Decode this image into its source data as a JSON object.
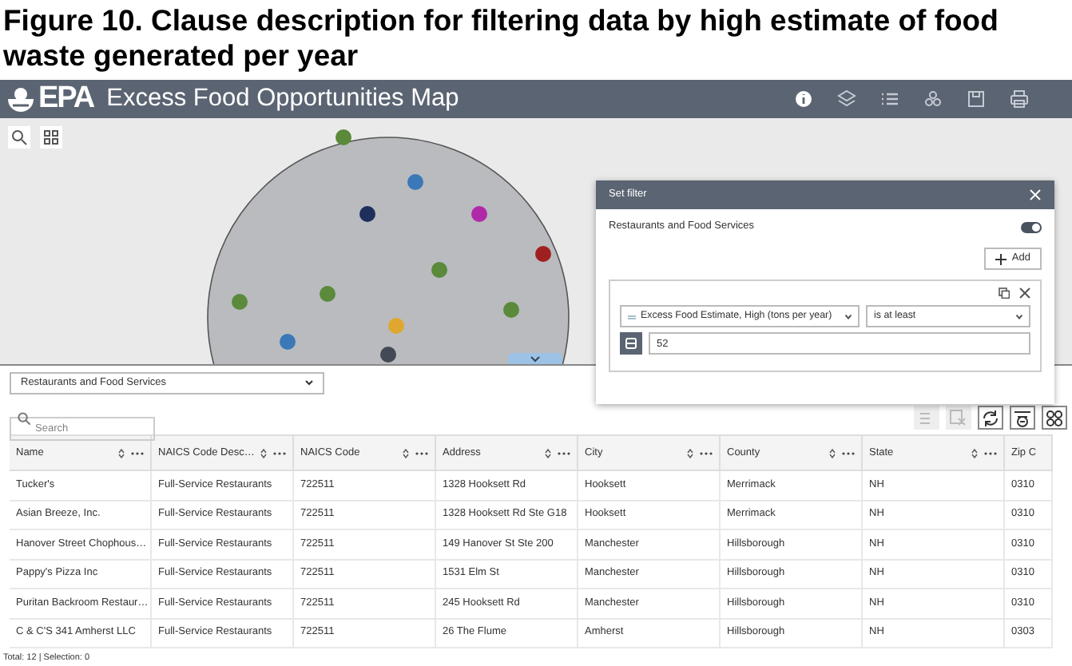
{
  "caption": "Figure 10. Clause description for filtering data by high estimate of food waste generated per year",
  "app": {
    "logo": "EPA",
    "title": "Excess Food Opportunities Map",
    "toolbar": [
      {
        "kind": "info",
        "selected": true
      },
      {
        "kind": "layers",
        "selected": false
      },
      {
        "kind": "list",
        "selected": false
      },
      {
        "kind": "people",
        "selected": false
      },
      {
        "kind": "save",
        "selected": false
      },
      {
        "kind": "print",
        "selected": false
      }
    ]
  },
  "filter": {
    "title": "Set filter",
    "layer": "Restaurants and Food Services",
    "on": true,
    "add_label": "Add",
    "field": "Excess Food Estimate, High (tons per year)",
    "operator": "is at least",
    "value": "52"
  },
  "table": {
    "layer": "Restaurants and Food Services",
    "search_placeholder": "Search",
    "tools": [
      {
        "kind": "select-all",
        "disabled": true
      },
      {
        "kind": "clear",
        "disabled": true
      },
      {
        "kind": "refresh",
        "disabled": false
      },
      {
        "kind": "filter",
        "disabled": false
      },
      {
        "kind": "options",
        "disabled": false
      }
    ],
    "columns": [
      "Name",
      "NAICS Code Desc…",
      "NAICS Code",
      "Address",
      "City",
      "County",
      "State",
      "Zip C"
    ],
    "rows": [
      [
        "Tucker's",
        "Full-Service Restaurants",
        "722511",
        "1328 Hooksett Rd",
        "Hooksett",
        "Merrimack",
        "NH",
        "0310"
      ],
      [
        "Asian Breeze, Inc.",
        "Full-Service Restaurants",
        "722511",
        "1328 Hooksett Rd Ste G18",
        "Hooksett",
        "Merrimack",
        "NH",
        "0310"
      ],
      [
        "Hanover Street Chophous…",
        "Full-Service Restaurants",
        "722511",
        "149 Hanover St Ste 200",
        "Manchester",
        "Hillsborough",
        "NH",
        "0310"
      ],
      [
        "Pappy's Pizza Inc",
        "Full-Service Restaurants",
        "722511",
        "1531 Elm St",
        "Manchester",
        "Hillsborough",
        "NH",
        "0310"
      ],
      [
        "Puritan Backroom Restaur…",
        "Full-Service Restaurants",
        "722511",
        "245 Hooksett Rd",
        "Manchester",
        "Hillsborough",
        "NH",
        "0310"
      ],
      [
        "C & C'S 341 Amherst LLC",
        "Full-Service Restaurants",
        "722511",
        "26 The Flume",
        "Amherst",
        "Hillsborough",
        "NH",
        "0303"
      ]
    ],
    "footer": "Total: 12 | Selection: 0"
  }
}
